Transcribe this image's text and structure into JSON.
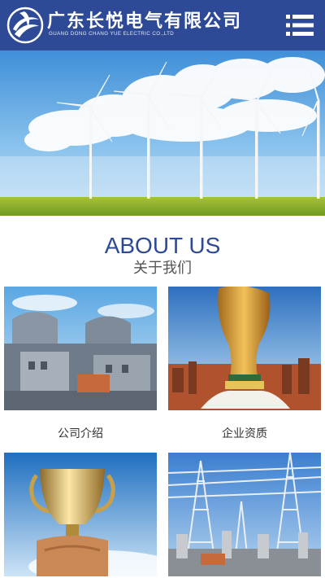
{
  "header": {
    "company_name_cn": "广东长悦电气有限公司",
    "company_name_en": "GUANG DONG CHANG YUE ELECTRIC CO.,LTD",
    "menu_icon": "hamburger-menu-icon",
    "logo_icon": "company-logo-icon",
    "background_color": "#2e4a97"
  },
  "banner": {
    "image": "wind-turbines-under-blue-sky"
  },
  "about": {
    "title": "ABOUT US",
    "subtitle": "关于我们",
    "title_color": "#2e4a97"
  },
  "cards": [
    {
      "label": "公司介绍",
      "image": "power-plant-buildings"
    },
    {
      "label": "企业资质",
      "image": "golden-trophy-city"
    },
    {
      "label": "",
      "image": "gold-cup-in-hand"
    },
    {
      "label": "",
      "image": "electrical-substation"
    }
  ]
}
